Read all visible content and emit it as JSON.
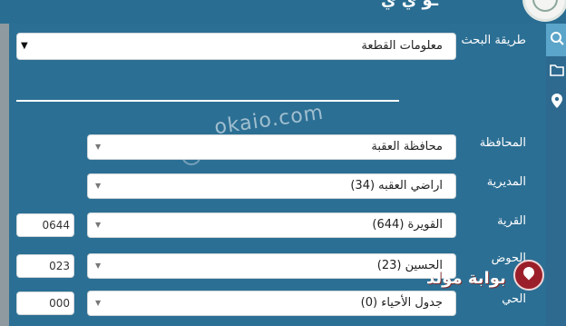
{
  "header": {
    "title": "ـو ي ي"
  },
  "sidebar": {
    "items": [
      {
        "icon": "search-icon"
      },
      {
        "icon": "folder-icon"
      },
      {
        "icon": "map-pin-icon"
      }
    ]
  },
  "search_method": {
    "label": "طريقة البحث",
    "value": "معلومات القطعة"
  },
  "fields": {
    "governorate": {
      "label": "المحافظة",
      "value": "محافظة العقبة"
    },
    "directorate": {
      "label": "المديرية",
      "value": "اراضي العقبه (34)"
    },
    "village": {
      "label": "القرية",
      "value": "القويرة (644)",
      "code": "0644"
    },
    "basin": {
      "label": "الحوض",
      "value": "الحسين (23)",
      "code": "023"
    },
    "neighborhood": {
      "label": "الحي",
      "value": "جدول الأحياء (0)",
      "code": "000"
    }
  },
  "watermark": {
    "text": "okaio.com"
  },
  "brand": {
    "text": "بوابة مولد"
  },
  "colors": {
    "background": "#2c6f94",
    "sidebar_active": "#5aa5c9",
    "brand": "#9b1f2a"
  }
}
